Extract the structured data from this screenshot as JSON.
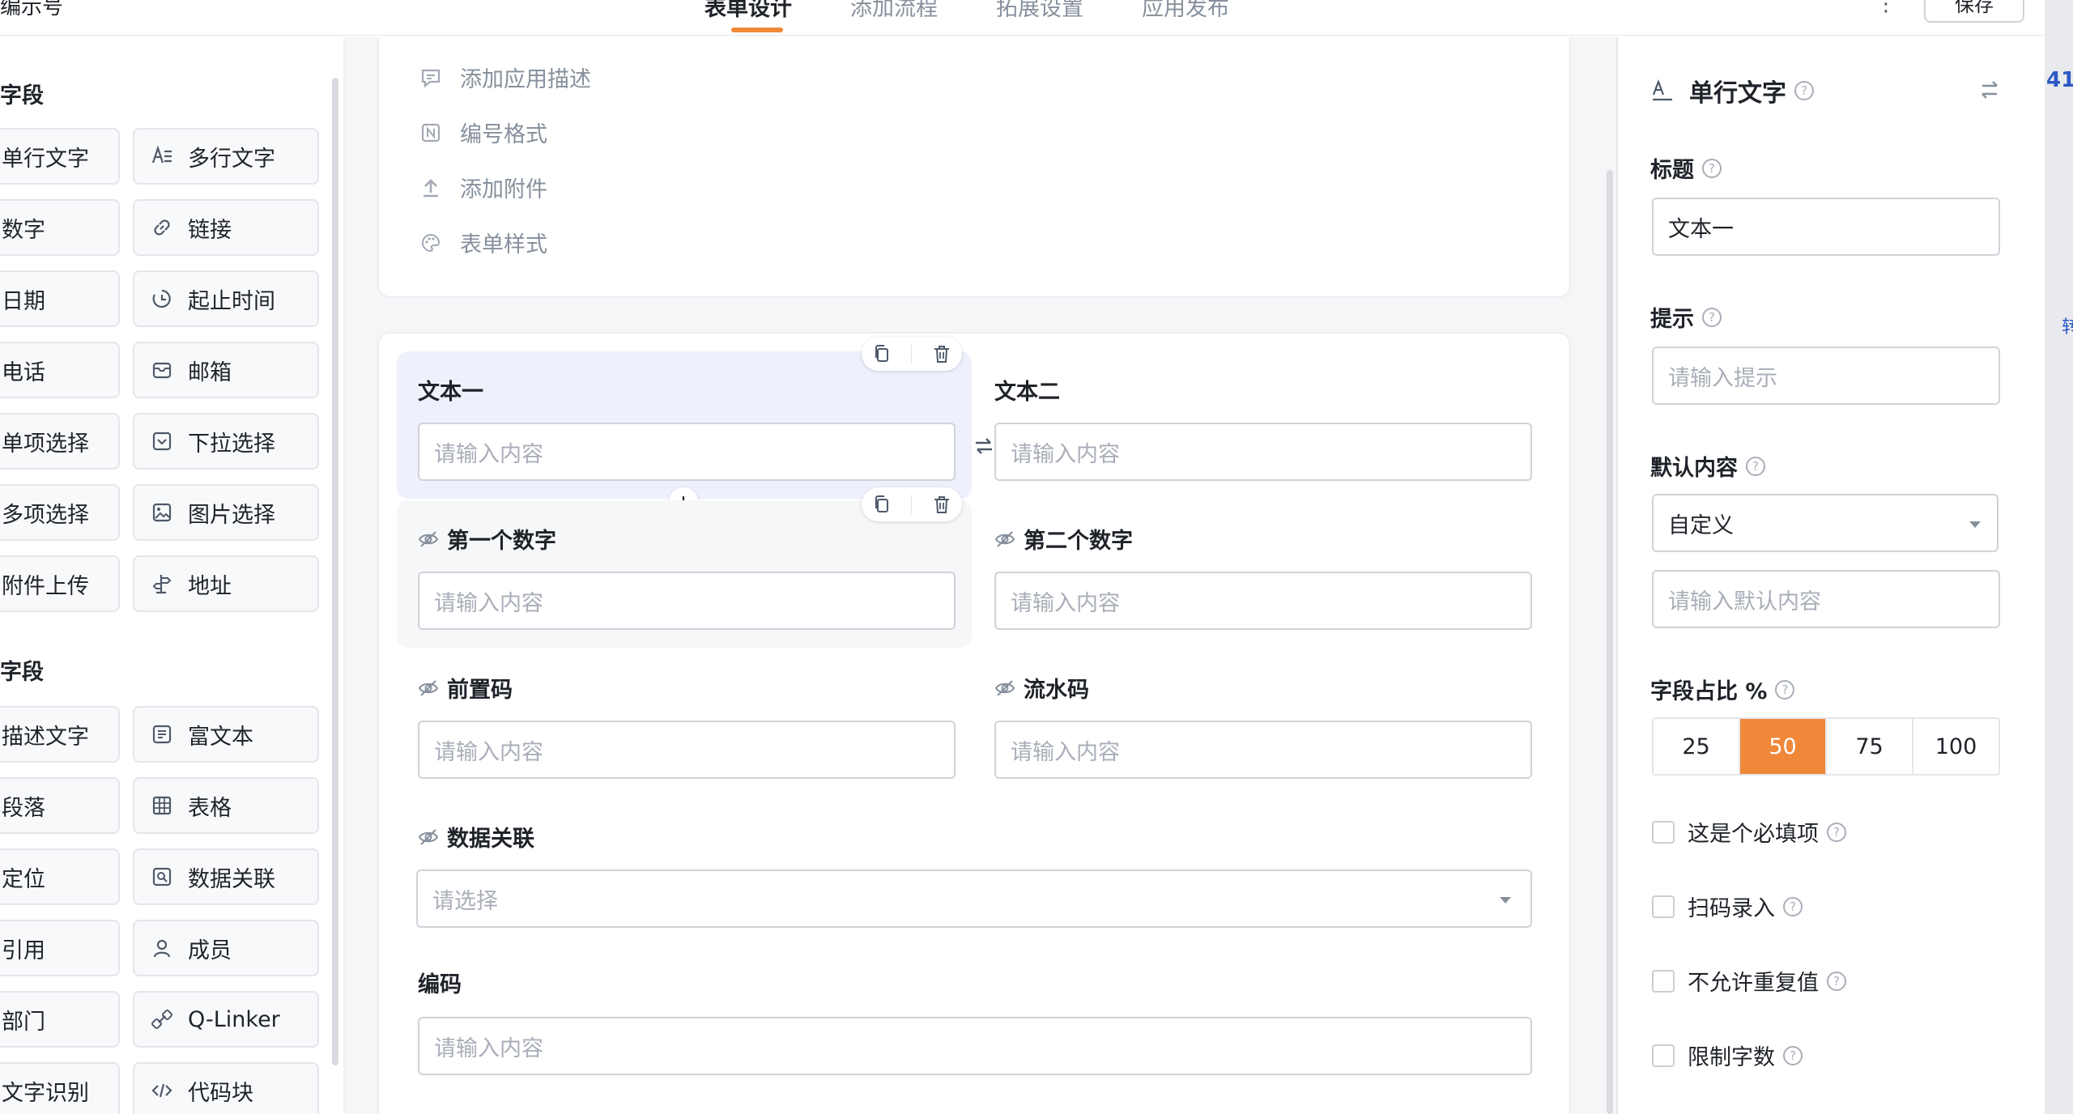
{
  "header": {
    "app_name": "编示号",
    "tabs": [
      {
        "label": "表单设计"
      },
      {
        "label": "添加流程"
      },
      {
        "label": "拓展设置"
      },
      {
        "label": "应用发布"
      }
    ],
    "more_label": "⋮",
    "save_label": "保存"
  },
  "palette": {
    "section1_title": "字段",
    "section2_title": "字段",
    "items_col1": [
      "单行文字",
      "数字",
      "日期",
      "电话",
      "单项选择",
      "多项选择",
      "附件上传"
    ],
    "items_col2": [
      "多行文字",
      "链接",
      "起止时间",
      "邮箱",
      "下拉选择",
      "图片选择",
      "地址"
    ],
    "items2_col1": [
      "描述文字",
      "段落",
      "定位",
      "引用",
      "部门",
      "文字识别"
    ],
    "items2_col2": [
      "富文本",
      "表格",
      "数据关联",
      "成员",
      "Q-Linker",
      "代码块"
    ]
  },
  "form_options": [
    {
      "label": "添加应用描述",
      "icon": "comment-icon"
    },
    {
      "label": "编号格式",
      "icon": "number-format-icon"
    },
    {
      "label": "添加附件",
      "icon": "upload-icon"
    },
    {
      "label": "表单样式",
      "icon": "palette-icon"
    }
  ],
  "form_fields": {
    "text1": {
      "label": "文本一",
      "placeholder": "请输入内容"
    },
    "text2": {
      "label": "文本二",
      "placeholder": "请输入内容"
    },
    "num1": {
      "label": "第一个数字",
      "placeholder": "请输入内容"
    },
    "num2": {
      "label": "第二个数字",
      "placeholder": "请输入内容"
    },
    "prefix": {
      "label": "前置码",
      "placeholder": "请输入内容"
    },
    "serial": {
      "label": "流水码",
      "placeholder": "请输入内容"
    },
    "relation": {
      "label": "数据关联",
      "placeholder": "请选择"
    },
    "code": {
      "label": "编码",
      "placeholder": "请输入内容"
    }
  },
  "properties": {
    "title": "单行文字",
    "label_title": "标题",
    "title_value": "文本一",
    "label_hint": "提示",
    "hint_placeholder": "请输入提示",
    "label_default": "默认内容",
    "default_mode": "自定义",
    "default_placeholder": "请输入默认内容",
    "label_width": "字段占比 %",
    "width_options": [
      "25",
      "50",
      "75",
      "100"
    ],
    "width_selected": "50",
    "checkboxes": [
      {
        "label": "这是个必填项",
        "checked": false
      },
      {
        "label": "扫码录入",
        "checked": false
      },
      {
        "label": "不允许重复值",
        "checked": false
      },
      {
        "label": "限制字数",
        "checked": false
      }
    ],
    "help_glyph": "?"
  },
  "edge": {
    "text1": "41",
    "text2": "转"
  },
  "colors": {
    "accent": "#f0883a",
    "selected_bg": "#eef1fb",
    "link": "#2b59c3"
  }
}
